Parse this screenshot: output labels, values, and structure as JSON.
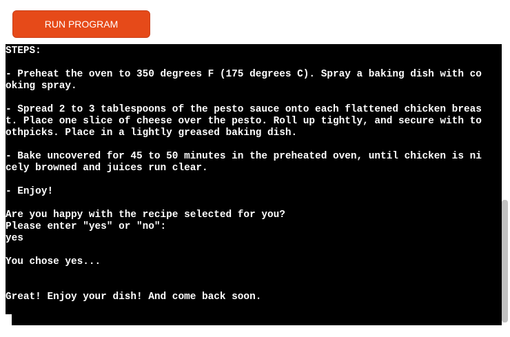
{
  "toolbar": {
    "run_label": "RUN PROGRAM",
    "run_color": "#e64a19"
  },
  "terminal": {
    "lines": [
      "STEPS:",
      "",
      "- Preheat the oven to 350 degrees F (175 degrees C). Spray a baking dish with co",
      "oking spray.",
      "",
      "- Spread 2 to 3 tablespoons of the pesto sauce onto each flattened chicken breas",
      "t. Place one slice of cheese over the pesto. Roll up tightly, and secure with to",
      "othpicks. Place in a lightly greased baking dish.",
      "",
      "- Bake uncovered for 45 to 50 minutes in the preheated oven, until chicken is ni",
      "cely browned and juices run clear.",
      "",
      "- Enjoy!",
      "",
      "Are you happy with the recipe selected for you?",
      "Please enter \"yes\" or \"no\":",
      "yes",
      "",
      "You chose yes...",
      "",
      "",
      "Great! Enjoy your dish! And come back soon."
    ],
    "background": "#000000",
    "foreground": "#ffffff"
  }
}
